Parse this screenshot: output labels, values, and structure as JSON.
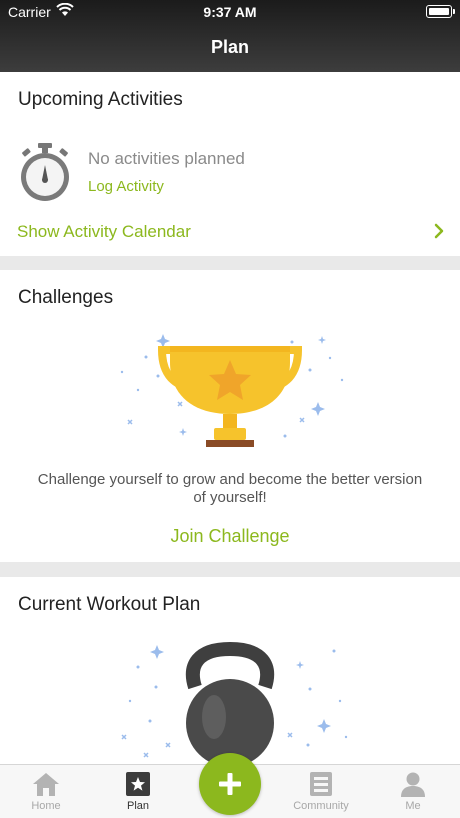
{
  "status_bar": {
    "carrier": "Carrier",
    "time": "9:37 AM"
  },
  "nav": {
    "title": "Plan"
  },
  "upcoming": {
    "title": "Upcoming Activities",
    "empty_text": "No activities planned",
    "log_link": "Log Activity",
    "calendar_link": "Show Activity Calendar"
  },
  "challenges": {
    "title": "Challenges",
    "description_line1": "Challenge yourself to grow and become the better version",
    "description_line2": "of yourself!",
    "join_button": "Join Challenge"
  },
  "workout": {
    "title": "Current Workout Plan"
  },
  "tabs": [
    {
      "label": "Home",
      "icon": "home-icon"
    },
    {
      "label": "Plan",
      "icon": "star-icon"
    },
    {
      "label": "Community",
      "icon": "community-icon"
    },
    {
      "label": "Me",
      "icon": "person-icon"
    }
  ],
  "fab": {
    "icon": "plus-icon"
  },
  "colors": {
    "accent": "#8cb81e",
    "header": "#2a2a2a",
    "trophy": "#f6c32c"
  }
}
